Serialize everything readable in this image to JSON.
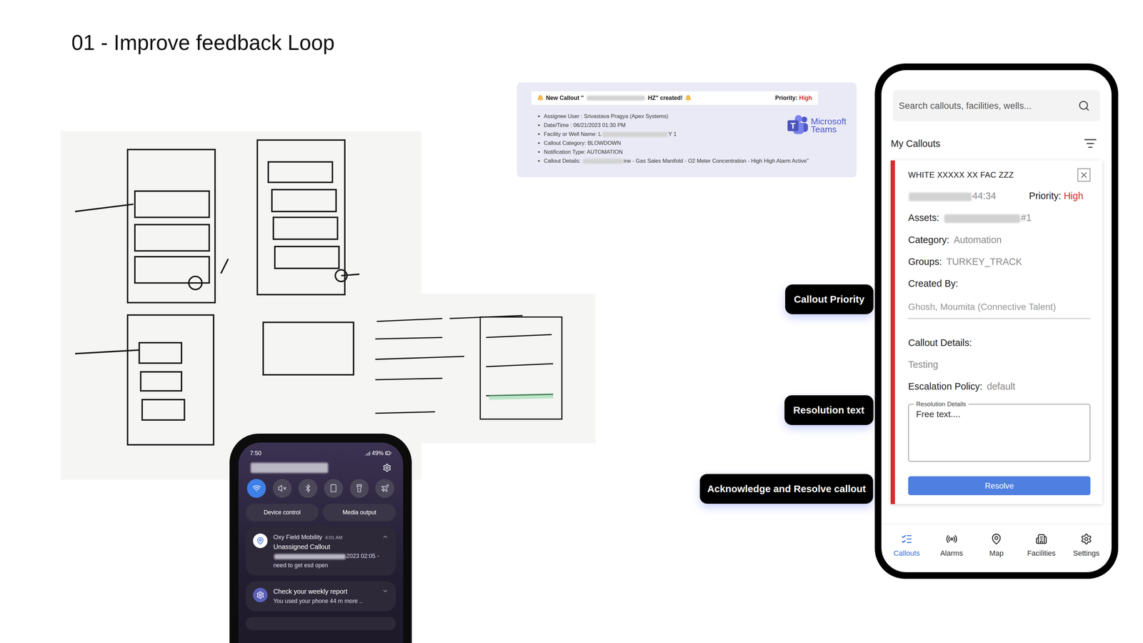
{
  "title": "01 - Improve feedback Loop",
  "teams": {
    "header": [
      {
        "kind": "text",
        "text": "New Callout \""
      },
      {
        "kind": "blur"
      },
      {
        "kind": "text",
        "text": "HZ\" created!"
      }
    ],
    "priority": {
      "label": "Priority:",
      "value": "High"
    },
    "items": [
      [
        {
          "kind": "text",
          "text": "Assignee User : Srivastava Pragya (Apex Systems)"
        }
      ],
      [
        {
          "kind": "text",
          "text": "Date/Time : 06/21/2023 01:30 PM"
        }
      ],
      [
        {
          "kind": "text",
          "text": "Facility or Well Name: L"
        },
        {
          "kind": "blur"
        },
        {
          "kind": "text",
          "text": "Y 1"
        }
      ],
      [
        {
          "kind": "text",
          "text": "Callout Category: BLOWDOWN"
        }
      ],
      [
        {
          "kind": "text",
          "text": "Notification Type: AUTOMATION"
        }
      ],
      [
        {
          "kind": "text",
          "text": "Callout Details: "
        },
        {
          "kind": "blur"
        },
        {
          "kind": "text",
          "text": "ine - Gas Sales Manifold - O2 Meter Concentration - High High Alarm Active\""
        }
      ]
    ],
    "logo_letter": "T",
    "brand": [
      "Microsoft",
      "Teams"
    ]
  },
  "android": {
    "time": "7:50",
    "battery": "49%",
    "toggles": [
      {
        "on": true
      },
      {
        "on": false
      },
      {
        "on": false
      },
      {
        "on": false
      },
      {
        "on": false
      },
      {
        "on": false
      }
    ],
    "buttons": [
      "Device control",
      "Media output"
    ],
    "notifications": [
      {
        "app": "Oxy Field Mobility",
        "time": "4:01 AM",
        "title": "Unassigned Callout",
        "expanded": true,
        "lines": [
          [
            {
              "kind": "blur"
            },
            {
              "kind": "text",
              "text": "2023 02:05 -"
            }
          ],
          [
            {
              "kind": "text",
              "text": "need to get esd open"
            }
          ]
        ]
      },
      {
        "app": "",
        "time": "",
        "title": "Check your weekly report",
        "expanded": false,
        "lines": [
          [
            {
              "kind": "text",
              "text": "You used your phone 44 m more .."
            }
          ]
        ]
      }
    ]
  },
  "labels": [
    "Callout Priority",
    "Resolution text",
    "Acknowledge and Resolve callout"
  ],
  "phone": {
    "search": {
      "placeholder": "Search callouts, facilities, wells..."
    },
    "section": "My Callouts",
    "callout": {
      "name": "WHITE XXXXX XX FAC ZZZ",
      "time": [
        {
          "kind": "blur"
        },
        {
          "kind": "text",
          "text": "44:34"
        }
      ],
      "priority": {
        "label": "Priority:",
        "value": "High"
      },
      "fields": [
        {
          "label": "Assets:",
          "value": [
            {
              "kind": "blur"
            },
            {
              "kind": "text",
              "text": "#1"
            }
          ]
        },
        {
          "label": "Category:",
          "value": [
            {
              "kind": "text",
              "text": "Automation"
            }
          ]
        },
        {
          "label": "Groups:",
          "value": [
            {
              "kind": "text",
              "text": "TURKEY_TRACK"
            }
          ]
        },
        {
          "label": "Created By:",
          "value": []
        }
      ],
      "created_by": "Ghosh, Moumita (Connective Talent)",
      "details_label": "Callout Details:",
      "details": "Testing",
      "escalation": {
        "label": "Escalation Policy:",
        "value": "default"
      },
      "resolution": {
        "legend": "Resolution Details",
        "placeholder": "Free text...."
      },
      "button": "Resolve"
    },
    "nav": [
      {
        "label": "Callouts",
        "selected": true
      },
      {
        "label": "Alarms",
        "selected": false
      },
      {
        "label": "Map",
        "selected": false
      },
      {
        "label": "Facilities",
        "selected": false
      },
      {
        "label": "Settings",
        "selected": false
      }
    ]
  }
}
